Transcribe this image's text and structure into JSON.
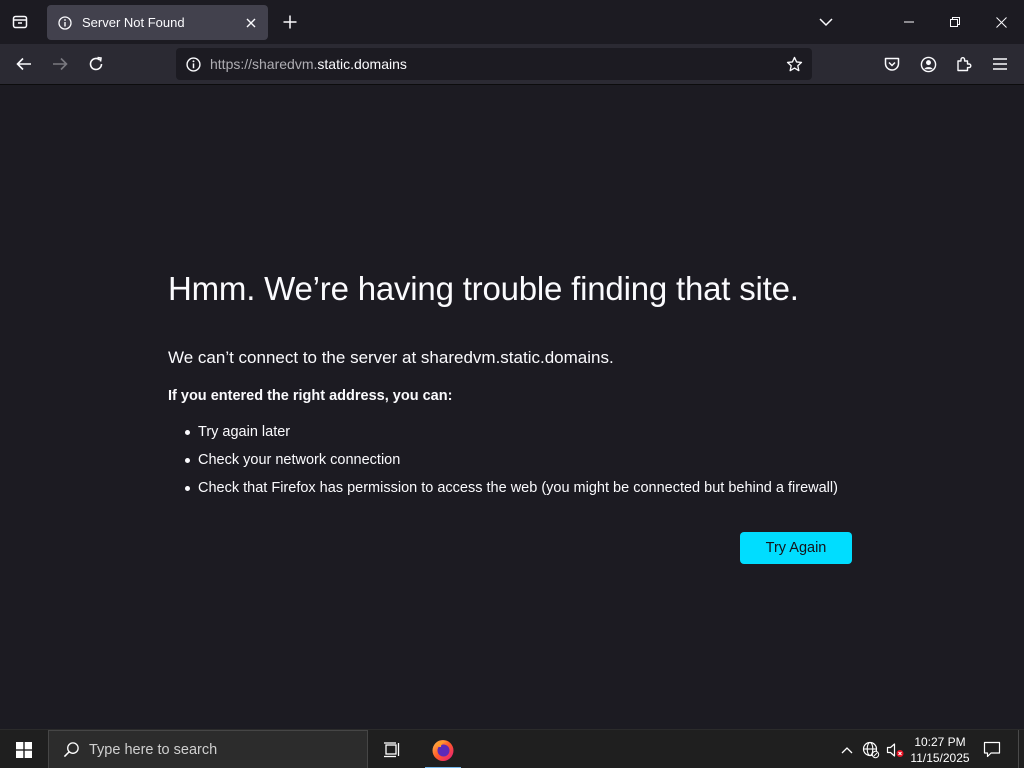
{
  "tab": {
    "title": "Server Not Found"
  },
  "urlbar": {
    "url_prefix": "https://sharedvm.",
    "url_host": "static.domains"
  },
  "error": {
    "title": "Hmm. We’re having trouble finding that site.",
    "description": "We can’t connect to the server at sharedvm.static.domains.",
    "subheading": "If you entered the right address, you can:",
    "suggestions": [
      "Try again later",
      "Check your network connection",
      "Check that Firefox has permission to access the web (you might be connected but behind a firewall)"
    ],
    "button_label": "Try Again"
  },
  "taskbar": {
    "search_placeholder": "Type here to search",
    "time": "10:27 PM",
    "date": "11/15/2025"
  },
  "colors": {
    "accent": "#00ddff",
    "page_bg": "#1c1b22",
    "toolbar_bg": "#2b2a33",
    "tab_selected": "#42414d"
  }
}
